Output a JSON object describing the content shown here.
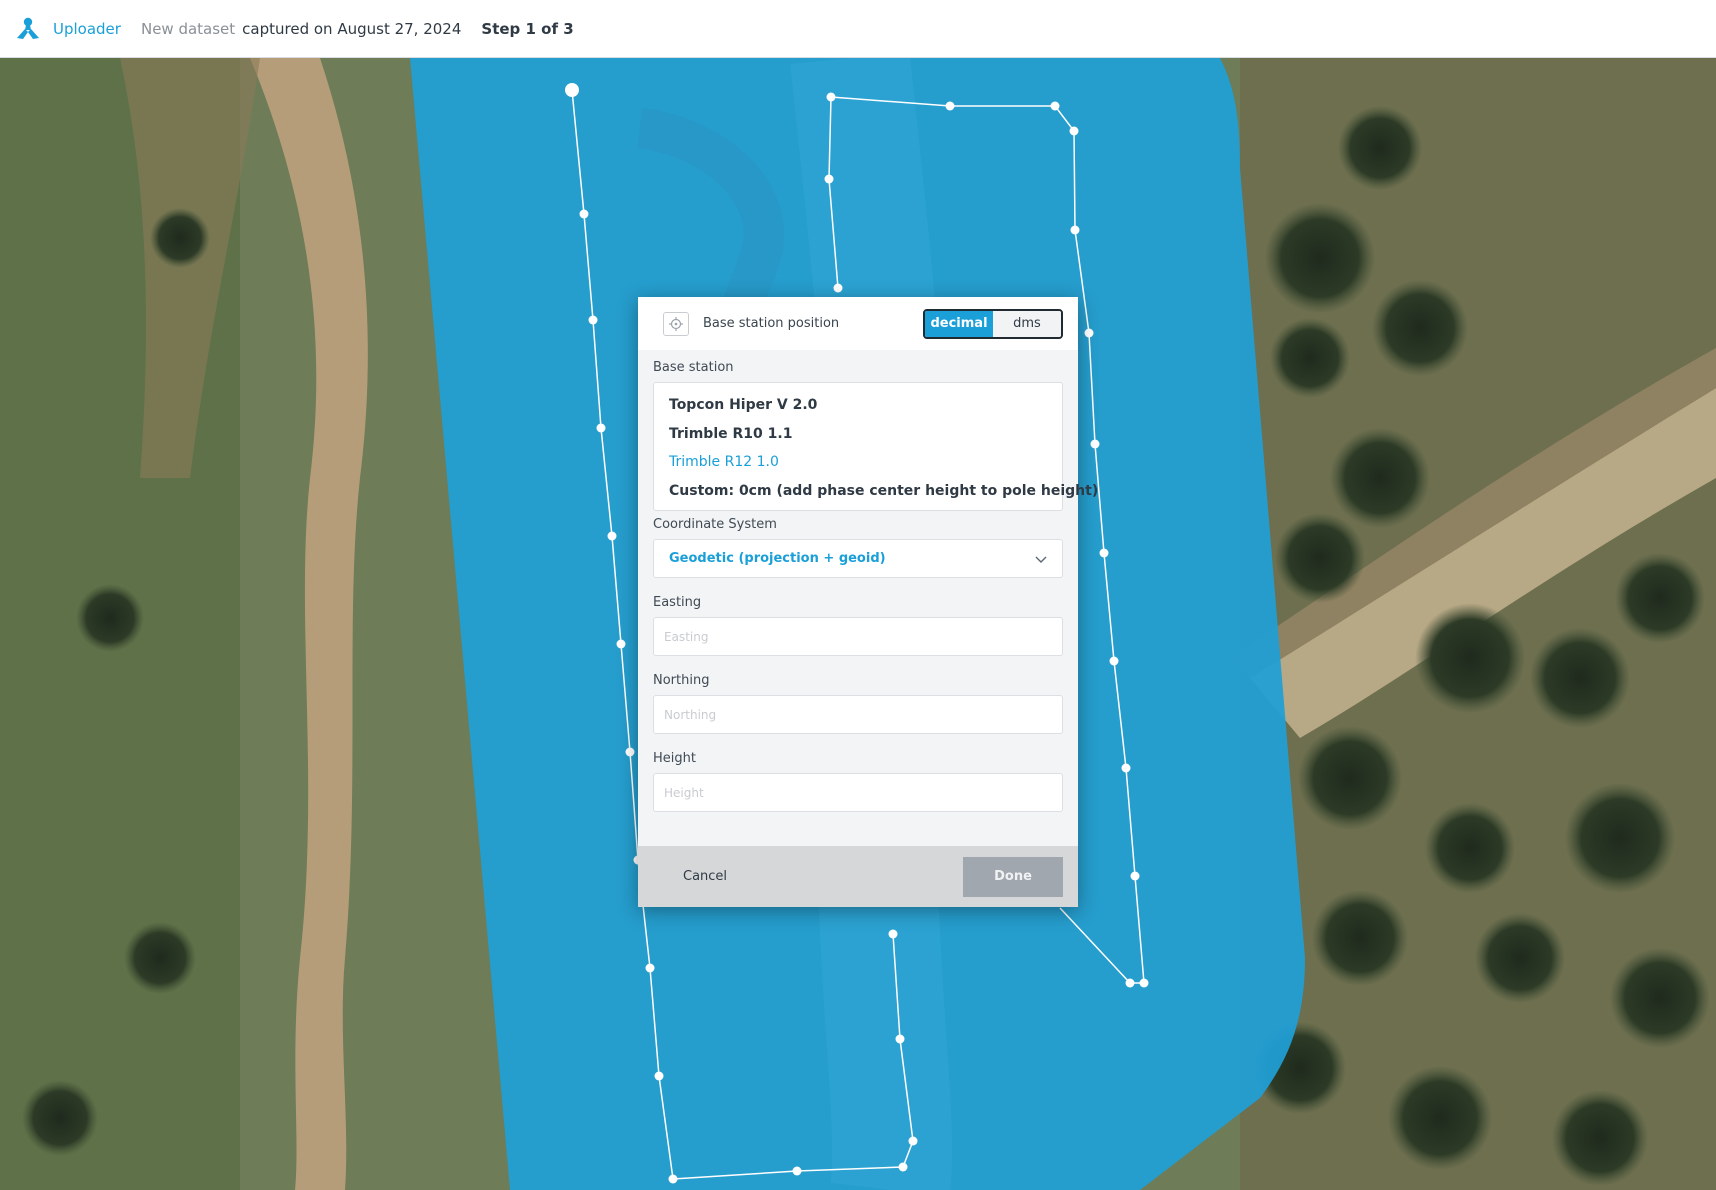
{
  "topbar": {
    "app_name": "Uploader",
    "dataset_label": "New dataset",
    "captured_text": "captured on August 27, 2024",
    "step_text": "Step 1 of 3",
    "brand_color": "#1a9fd8"
  },
  "dialog": {
    "title": "Base station position",
    "format_toggle": {
      "options": [
        "decimal",
        "dms"
      ],
      "selected": "decimal"
    },
    "base_station": {
      "label": "Base station",
      "options": [
        "Topcon Hiper V 2.0",
        "Trimble R10 1.1",
        "Trimble R12 1.0",
        "Custom: 0cm (add phase center height to pole height)"
      ],
      "selected_index": 2
    },
    "coordinate_system": {
      "label": "Coordinate System",
      "value": "Geodetic (projection + geoid)"
    },
    "easting": {
      "label": "Easting",
      "placeholder": "Easting",
      "value": ""
    },
    "northing": {
      "label": "Northing",
      "placeholder": "Northing",
      "value": ""
    },
    "height": {
      "label": "Height",
      "placeholder": "Height",
      "value": ""
    },
    "cancel_label": "Cancel",
    "done_label": "Done"
  },
  "map": {
    "coverage_color": "#1f9fd6",
    "flight_path_color": "#ffffff"
  },
  "icons": {
    "logo": "uploader-logo-icon",
    "position": "crosshair-icon",
    "dropdown": "chevron-down-icon"
  }
}
